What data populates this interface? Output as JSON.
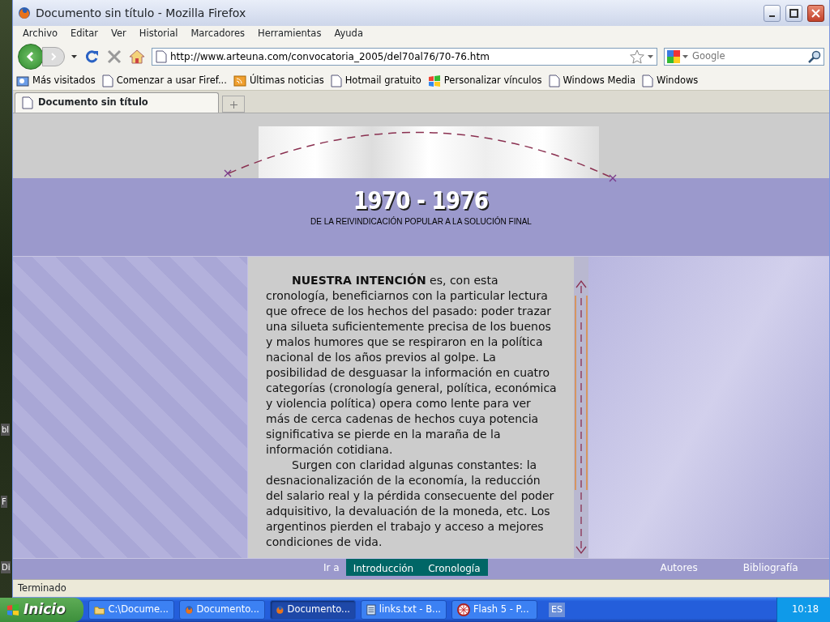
{
  "desktop": {
    "icon_labels": [
      "bl",
      "F",
      "Di"
    ]
  },
  "window": {
    "title": "Documento sin título - Mozilla Firefox"
  },
  "menu": [
    "Archivo",
    "Editar",
    "Ver",
    "Historial",
    "Marcadores",
    "Herramientas",
    "Ayuda"
  ],
  "address_bar": {
    "value": "http://www.arteuna.com/convocatoria_2005/del70al76/70-76.htm"
  },
  "search": {
    "placeholder": "Google"
  },
  "bookmarks": [
    {
      "label": "Más visitados",
      "kind": "smart"
    },
    {
      "label": "Comenzar a usar Firef...",
      "kind": "page"
    },
    {
      "label": "Últimas noticias",
      "kind": "feed"
    },
    {
      "label": "Hotmail gratuito",
      "kind": "page"
    },
    {
      "label": "Personalizar vínculos",
      "kind": "windows"
    },
    {
      "label": "Windows Media",
      "kind": "page"
    },
    {
      "label": "Windows",
      "kind": "page"
    }
  ],
  "tabs": [
    {
      "label": "Documento sin título",
      "selected": true
    }
  ],
  "page": {
    "title": "1970 - 1976",
    "subtitle": "DE LA REIVINDICACIÓN POPULAR A LA SOLUCIÓN FINAL",
    "paragraphs": [
      "**NUESTRA INTENCIÓN** es, con esta cronología, beneficiarnos con la particular lectura que ofrece de los hechos del pasado: poder trazar una silueta suficientemente precisa de los buenos y malos humores que se respiraron en la política nacional de los años previos al golpe. La posibilidad de desguasar la información en cuatro categorías (cronología general, política, económica y violencia política) opera como lente para ver más de cerca cadenas de hechos cuya potencia significativa se pierde en la maraña de la información cotidiana.",
      "Surgen con claridad algunas constantes:  la desnacionalización de la economía, la reducción del salario real y la pérdida consecuente del poder adquisitivo, la devaluación de la moneda, etc. Los argentinos pierden el trabajo y acceso a mejores condiciones de vida."
    ],
    "nav_label": "Ir a",
    "nav_links": [
      "Introducción",
      "Cronología"
    ],
    "right_links": [
      "Autores",
      "Bibliografía"
    ]
  },
  "status_bar": "Terminado",
  "taskbar": {
    "start": "Inicio",
    "tasks": [
      {
        "label": "C:\\Docume...",
        "kind": "folder",
        "selected": false
      },
      {
        "label": "Documento...",
        "kind": "firefox",
        "selected": false
      },
      {
        "label": "Documento...",
        "kind": "firefox",
        "selected": true
      },
      {
        "label": "links.txt - B...",
        "kind": "notepad",
        "selected": false
      },
      {
        "label": "Flash 5 - P...",
        "kind": "flash",
        "selected": false
      }
    ],
    "language": "ES",
    "clock": "10:18"
  }
}
